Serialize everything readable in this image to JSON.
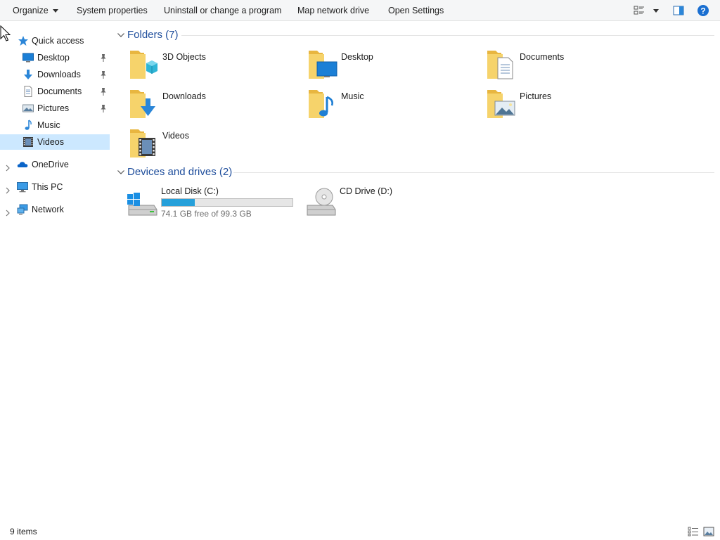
{
  "toolbar": {
    "organize": "Organize",
    "system_properties": "System properties",
    "uninstall": "Uninstall or change a program",
    "map_drive": "Map network drive",
    "open_settings": "Open Settings"
  },
  "nav": {
    "quick_access": "Quick access",
    "pinned": [
      {
        "label": "Desktop",
        "icon": "desktop-icon",
        "pinned": true
      },
      {
        "label": "Downloads",
        "icon": "downloads-icon",
        "pinned": true
      },
      {
        "label": "Documents",
        "icon": "documents-icon",
        "pinned": true
      },
      {
        "label": "Pictures",
        "icon": "pictures-icon",
        "pinned": true
      },
      {
        "label": "Music",
        "icon": "music-icon",
        "pinned": false
      },
      {
        "label": "Videos",
        "icon": "videos-icon",
        "pinned": false,
        "selected": true
      }
    ],
    "onedrive": "OneDrive",
    "this_pc": "This PC",
    "network": "Network"
  },
  "folders_group": {
    "title": "Folders (7)",
    "items": [
      {
        "label": "3D Objects",
        "icon": "3d-objects-folder-icon"
      },
      {
        "label": "Desktop",
        "icon": "desktop-folder-icon"
      },
      {
        "label": "Documents",
        "icon": "documents-folder-icon"
      },
      {
        "label": "Downloads",
        "icon": "downloads-folder-icon"
      },
      {
        "label": "Music",
        "icon": "music-folder-icon"
      },
      {
        "label": "Pictures",
        "icon": "pictures-folder-icon"
      },
      {
        "label": "Videos",
        "icon": "videos-folder-icon"
      }
    ]
  },
  "drives_group": {
    "title": "Devices and drives (2)",
    "local_disk": {
      "label": "Local Disk (C:)",
      "free_text": "74.1 GB free of 99.3 GB",
      "used_fraction": 0.254
    },
    "cd_drive": {
      "label": "CD Drive (D:)"
    }
  },
  "status": {
    "items": "9 items"
  },
  "colors": {
    "accent": "#26a0da",
    "selected": "#cce8ff",
    "group_heading": "#1f4e9c",
    "folder": "#f3c74c"
  }
}
